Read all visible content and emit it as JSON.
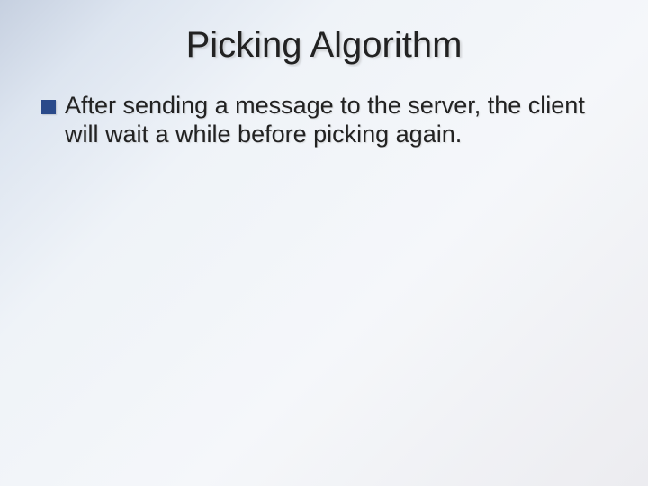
{
  "slide": {
    "title": "Picking Algorithm",
    "bullets": [
      {
        "text": "After sending a message to the server, the client will wait a while before picking again."
      }
    ]
  },
  "colors": {
    "bullet": "#2a4a8a",
    "text": "#222222"
  }
}
